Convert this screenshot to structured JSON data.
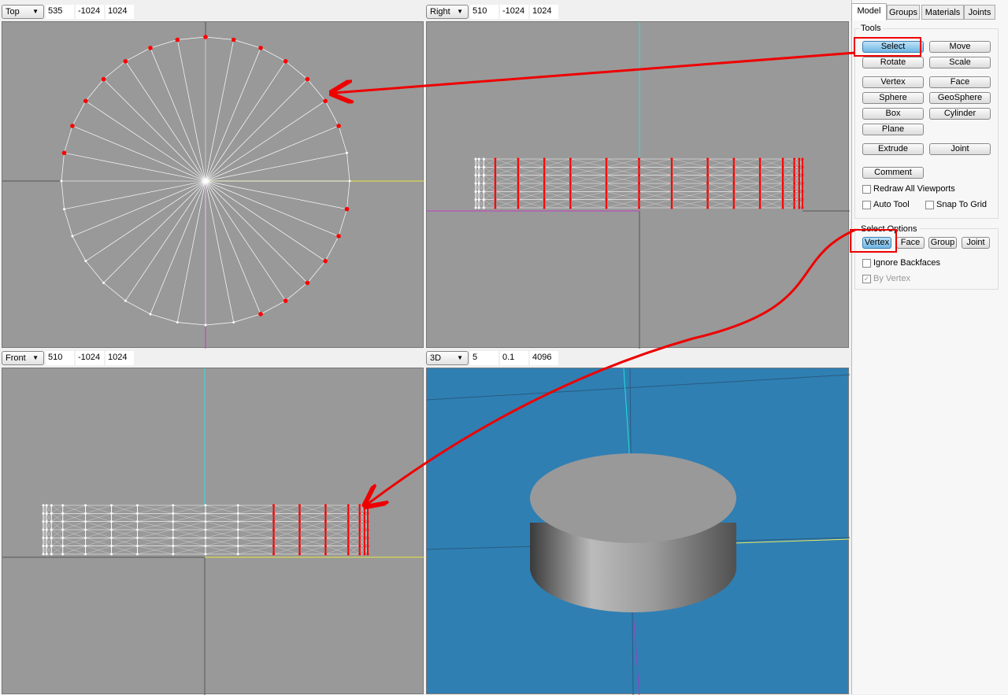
{
  "viewports": [
    {
      "view": "Top",
      "v1": "535",
      "v2": "-1024",
      "v3": "1024"
    },
    {
      "view": "Right",
      "v1": "510",
      "v2": "-1024",
      "v3": "1024"
    },
    {
      "view": "Front",
      "v1": "510",
      "v2": "-1024",
      "v3": "1024"
    },
    {
      "view": "3D",
      "v1": "5",
      "v2": "0.1",
      "v3": "4096"
    }
  ],
  "tabs": [
    "Model",
    "Groups",
    "Materials",
    "Joints"
  ],
  "tools": {
    "label": "Tools",
    "buttons": [
      "Select",
      "Move",
      "Rotate",
      "Scale",
      "Vertex",
      "Face",
      "Sphere",
      "GeoSphere",
      "Box",
      "Cylinder",
      "Plane",
      "Extrude",
      "Joint",
      "Comment"
    ],
    "checks": [
      "Redraw All Viewports",
      "Auto Tool",
      "Snap To Grid"
    ]
  },
  "select_options": {
    "label": "Select Options",
    "buttons": [
      "Vertex",
      "Face",
      "Group",
      "Joint"
    ],
    "checks": [
      "Ignore Backfaces",
      "By Vertex"
    ]
  },
  "colors": {
    "viewport": "#999999",
    "viewport3d": "#2f7fb3",
    "selected": "#ff0000",
    "annotation": "#e00000"
  }
}
